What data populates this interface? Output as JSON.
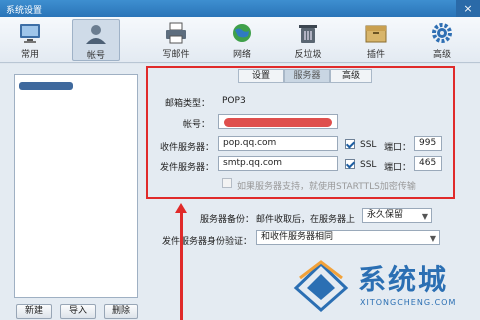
{
  "window": {
    "title": "系统设置",
    "close": "×"
  },
  "toolbar": {
    "items": [
      {
        "label": "常用"
      },
      {
        "label": "帐号"
      },
      {
        "label": "写邮件"
      },
      {
        "label": "网络"
      },
      {
        "label": "反垃圾"
      },
      {
        "label": "插件"
      },
      {
        "label": "高级"
      }
    ]
  },
  "tabs": [
    {
      "label": "设置"
    },
    {
      "label": "服务器"
    },
    {
      "label": "高级"
    }
  ],
  "server": {
    "mailbox_type_label": "邮箱类型：",
    "mailbox_type_value": "POP3",
    "account_label": "帐号：",
    "incoming_label": "收件服务器：",
    "incoming_value": "pop.qq.com",
    "outgoing_label": "发件服务器：",
    "outgoing_value": "smtp.qq.com",
    "ssl_label": "SSL",
    "port_label": "端口：",
    "incoming_port": "995",
    "outgoing_port": "465",
    "starttls_text": "如果服务器支持，就使用STARTTLS加密传输"
  },
  "backup": {
    "label": "服务器备份：",
    "text": "邮件收取后，在服务器上",
    "selected": "永久保留"
  },
  "outgoing_auth": {
    "label": "发件服务器身份验证：",
    "selected": "和收件服务器相同"
  },
  "buttons": {
    "new": "新建",
    "import": "导入",
    "delete": "删除"
  },
  "watermark": {
    "text": "系统城",
    "sub": "XITONGCHENG.COM"
  }
}
